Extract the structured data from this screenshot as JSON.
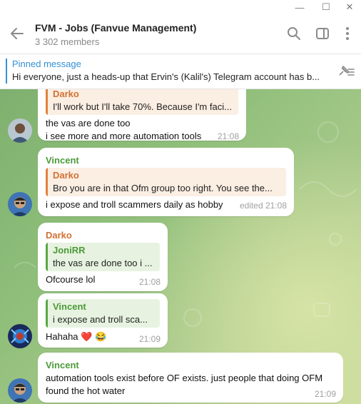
{
  "window": {
    "minimize": "—",
    "maximize": "☐",
    "close": "✕"
  },
  "header": {
    "title": "FVM - Jobs (Fanvue Management)",
    "members": "3 302 members",
    "icons": [
      "back-arrow-icon",
      "search-icon",
      "sidebar-toggle-icon",
      "more-vertical-icon"
    ]
  },
  "pinned": {
    "title": "Pinned message",
    "text": "Hi everyone, just a heads-up that Ervin's (Kalil's) Telegram account has b..."
  },
  "colors": {
    "accent": "#3390d4",
    "darko": "#d07232",
    "vincent": "#4c9a39",
    "bg_green": "#8fbf7a"
  },
  "messages": [
    {
      "quote_name": "Darko",
      "quote_text": "I'll work but I'll take 70%. Because I'm faci...",
      "lines": [
        "the vas are done too",
        "i see more and more automation tools"
      ],
      "time": "21:08"
    },
    {
      "sender": "Vincent",
      "quote_name": "Darko",
      "quote_text": "Bro you are in that Ofm group too right. You see the...",
      "lines": [
        "i expose and troll scammers daily as hobby"
      ],
      "time": "edited 21:08"
    },
    {
      "sender": "Darko",
      "quote_name": "JoniRR",
      "quote_text": "the vas are done too  i ...",
      "lines": [
        "Ofcourse lol"
      ],
      "time": "21:08"
    },
    {
      "quote_name": "Vincent",
      "quote_text": "i expose and troll sca...",
      "lines": [
        "Hahaha ❤️ 😂"
      ],
      "time": "21:09"
    },
    {
      "sender": "Vincent",
      "lines": [
        "automation tools exist before OF exists. just people that doing OFM",
        "found the hot water"
      ],
      "time": "21:09"
    }
  ]
}
